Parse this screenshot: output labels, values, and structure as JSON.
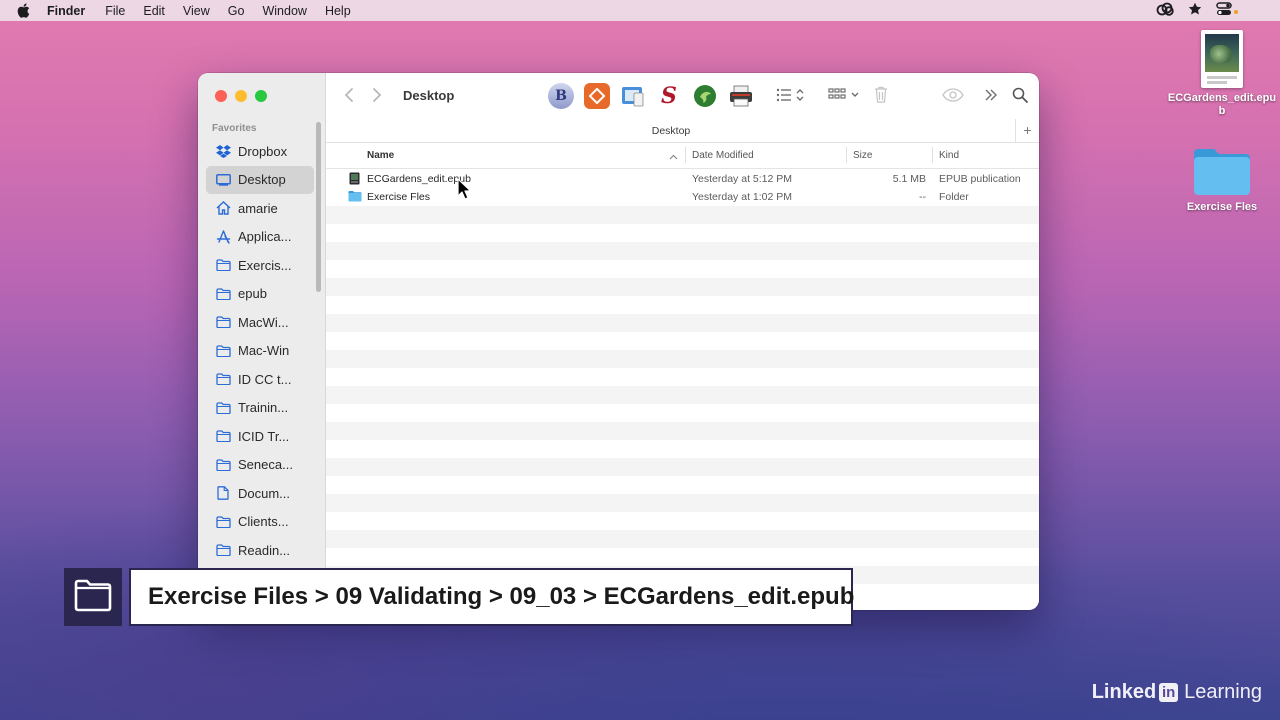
{
  "menubar": {
    "app_name": "Finder",
    "items": [
      "File",
      "Edit",
      "View",
      "Go",
      "Window",
      "Help"
    ],
    "icons": [
      "apple-icon",
      "creative-cloud-icon",
      "star-icon",
      "control-center-icon"
    ]
  },
  "desktop": {
    "icons": [
      {
        "label": "ECGardens_edit.epub",
        "icon": "epub-document-icon"
      },
      {
        "label": "Exercise Fles",
        "icon": "folder-icon"
      }
    ]
  },
  "window": {
    "title": "Desktop",
    "path_title": "Desktop",
    "sidebar": {
      "section": "Favorites",
      "items": [
        {
          "label": "Dropbox",
          "icon": "dropbox-icon"
        },
        {
          "label": "Desktop",
          "icon": "desktop-icon",
          "selected": true
        },
        {
          "label": "amarie",
          "icon": "home-icon"
        },
        {
          "label": "Applica...",
          "icon": "applications-icon"
        },
        {
          "label": "Exercis...",
          "icon": "folder-icon"
        },
        {
          "label": "epub",
          "icon": "folder-icon"
        },
        {
          "label": "MacWi...",
          "icon": "folder-icon"
        },
        {
          "label": "Mac-Win",
          "icon": "folder-icon"
        },
        {
          "label": "ID CC t...",
          "icon": "folder-icon"
        },
        {
          "label": "Trainin...",
          "icon": "folder-icon"
        },
        {
          "label": "ICID Tr...",
          "icon": "folder-icon"
        },
        {
          "label": "Seneca...",
          "icon": "folder-icon"
        },
        {
          "label": "Docum...",
          "icon": "document-icon"
        },
        {
          "label": "Clients...",
          "icon": "folder-icon"
        },
        {
          "label": "Readin...",
          "icon": "folder-icon"
        }
      ]
    },
    "toolbar_apps": [
      {
        "name": "bbedit-icon",
        "glyph": "B",
        "color": "#3e4a8c"
      },
      {
        "name": "ebook-reader-icon",
        "glyph": "",
        "color": "#e86a2a"
      },
      {
        "name": "preview-icon",
        "glyph": "",
        "color": "#3a86d8"
      },
      {
        "name": "scrivener-icon",
        "glyph": "S",
        "color": "#ffffff"
      },
      {
        "name": "epubcheck-icon",
        "glyph": "",
        "color": "#2f7d32"
      },
      {
        "name": "printer-icon",
        "glyph": "",
        "color": "#444444"
      }
    ],
    "columns": {
      "name": "Name",
      "date": "Date Modified",
      "size": "Size",
      "kind": "Kind"
    },
    "files": [
      {
        "name": "ECGardens_edit.epub",
        "date": "Yesterday at 5:12 PM",
        "size": "5.1 MB",
        "kind": "EPUB publication",
        "icon": "epub-file-icon"
      },
      {
        "name": "Exercise Fles",
        "date": "Yesterday at 1:02 PM",
        "size": "--",
        "kind": "Folder",
        "icon": "folder-icon"
      }
    ]
  },
  "caption": {
    "text": "Exercise Files > 09 Validating > 09_03 > ECGardens_edit.epub"
  },
  "brand": {
    "part1": "Linked",
    "in": "in",
    "part2": "Learning"
  },
  "colors": {
    "caption_border": "#2b2650",
    "folder_blue": "#5ab4ea",
    "close": "#fe5f57",
    "minimize": "#febc2e",
    "zoom": "#28c840"
  }
}
